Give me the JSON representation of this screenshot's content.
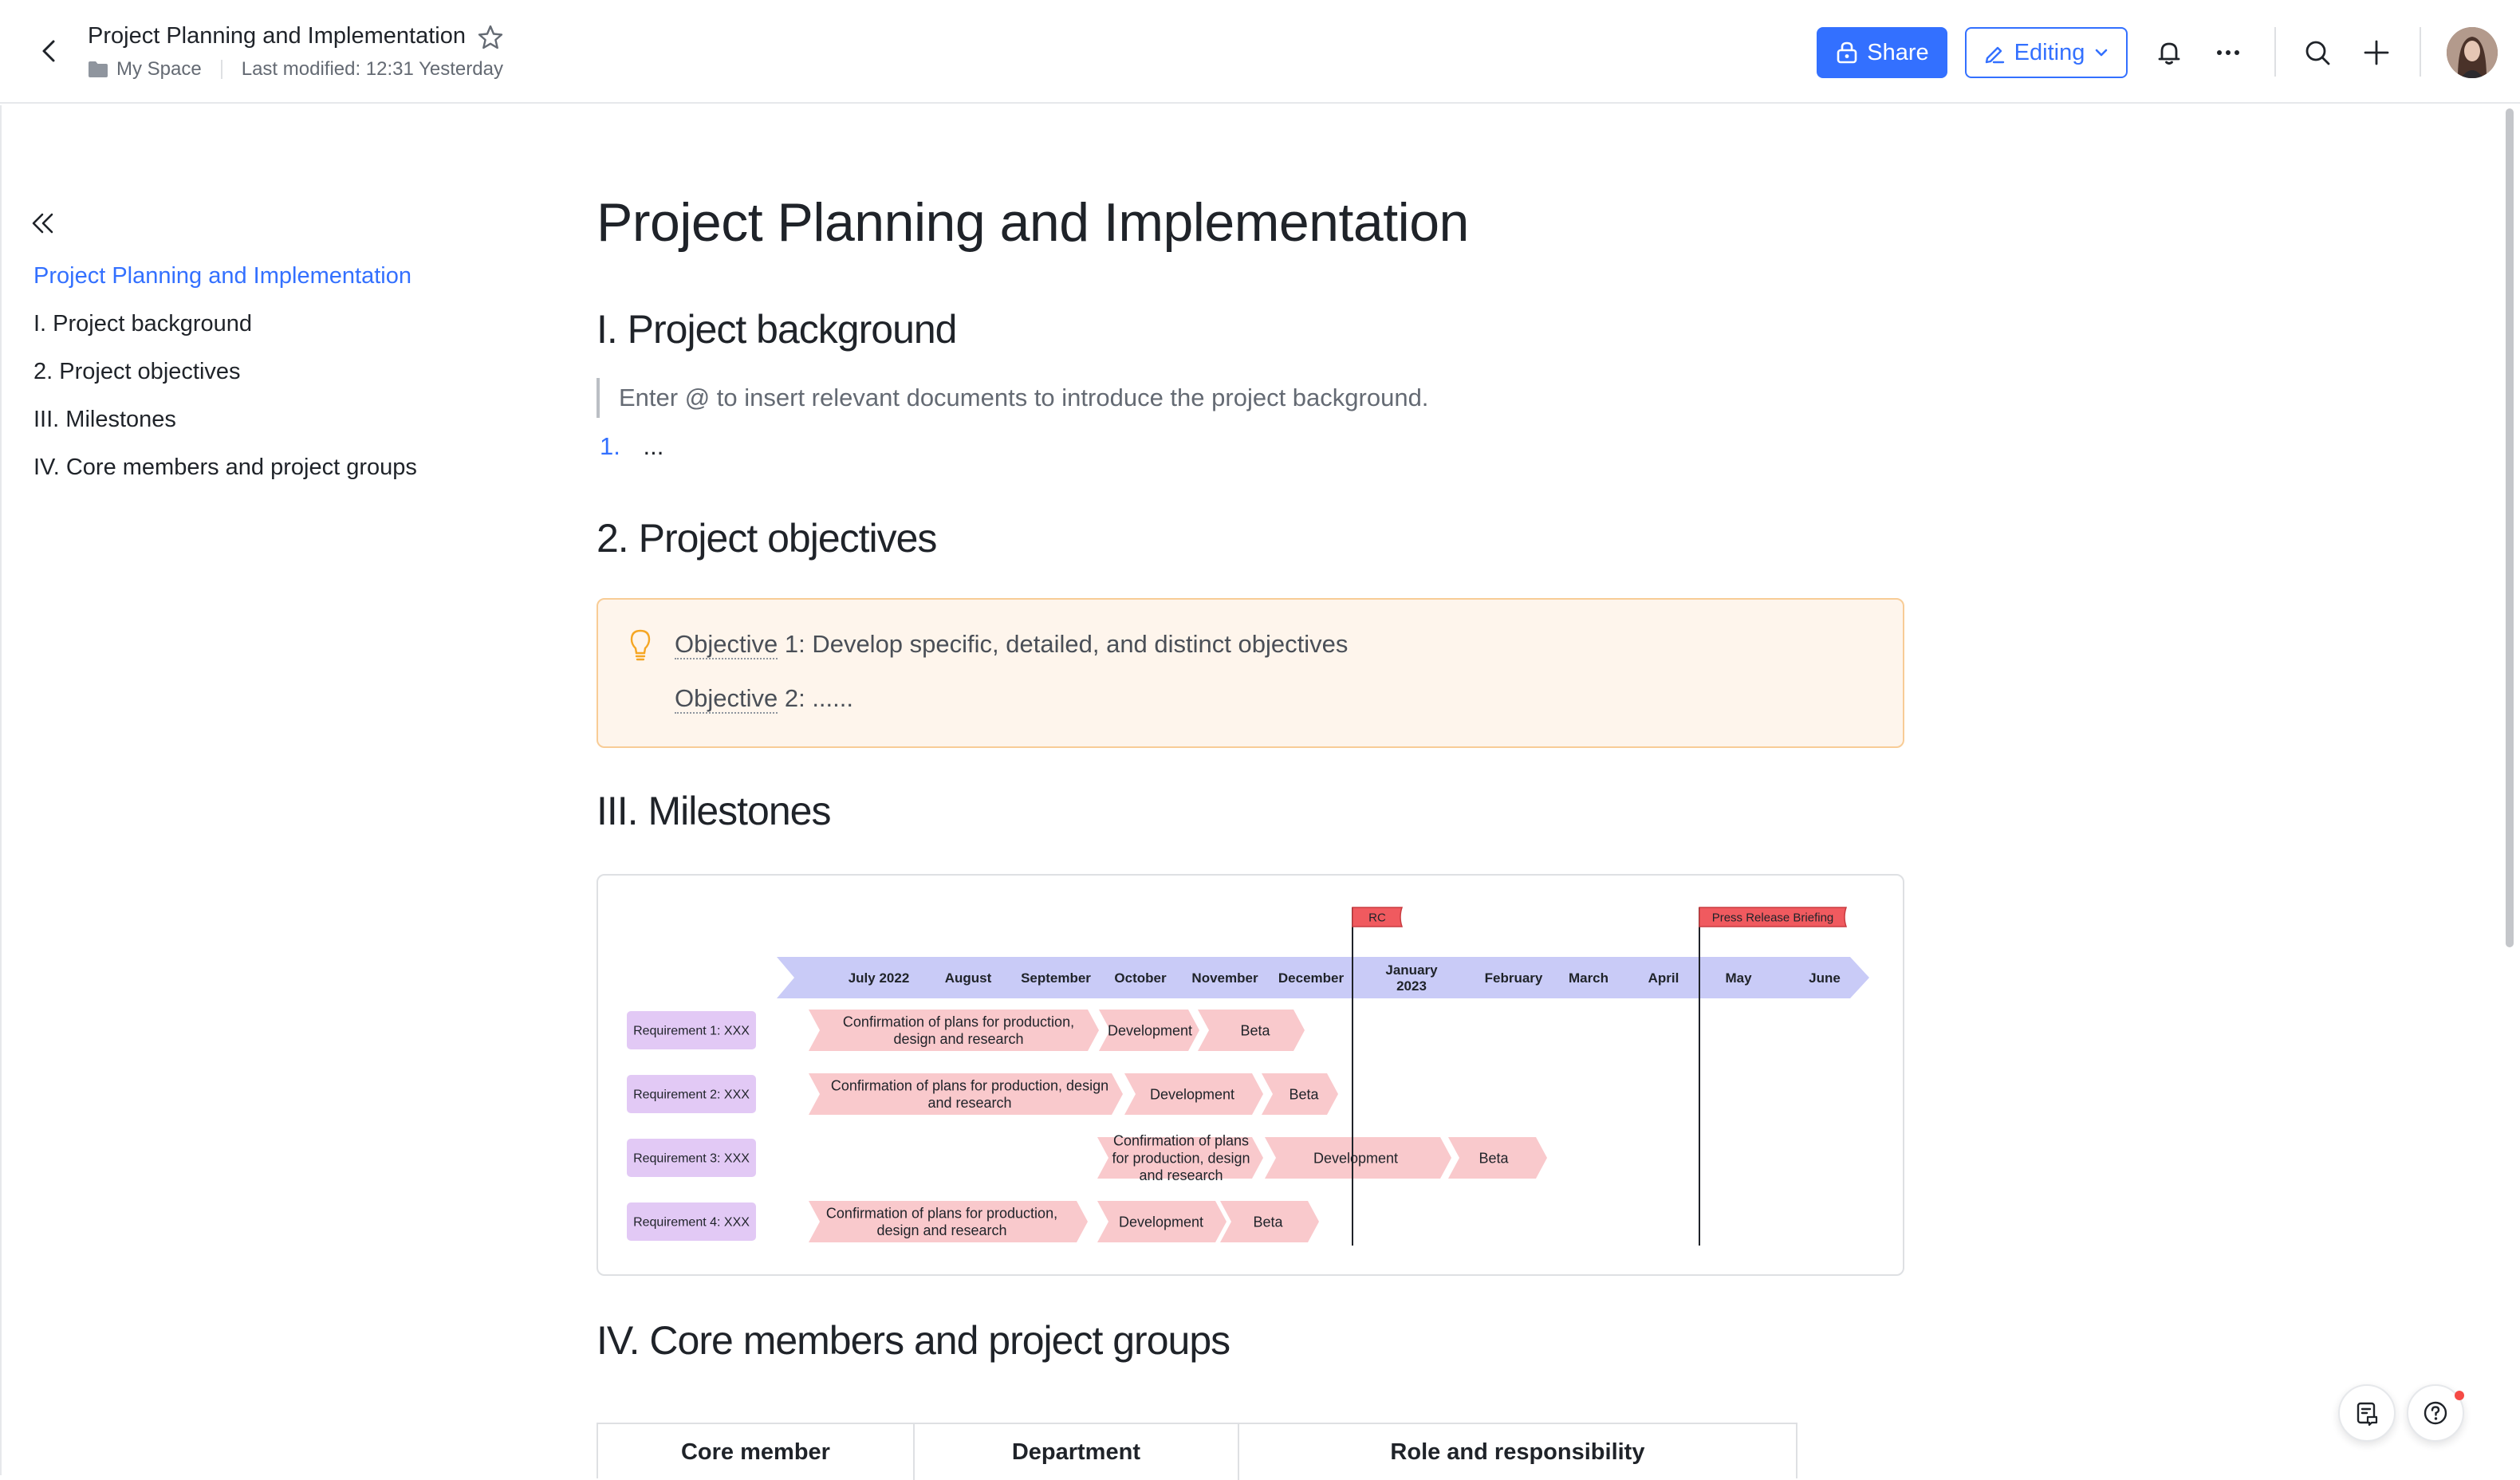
{
  "header": {
    "title": "Project Planning and Implementation",
    "location": "My Space",
    "last_modified": "Last modified: 12:31 Yesterday",
    "share_label": "Share",
    "editing_label": "Editing"
  },
  "outline": {
    "items": [
      {
        "label": "Project Planning and Implementation",
        "active": true
      },
      {
        "label": "I. Project background"
      },
      {
        "label": "2. Project objectives"
      },
      {
        "label": "III. Milestones"
      },
      {
        "label": "IV. Core members and project groups"
      }
    ]
  },
  "doc": {
    "title": "Project Planning and Implementation",
    "section1": {
      "heading": "I. Project background",
      "quote": "Enter @ to insert relevant documents to introduce the project background.",
      "list_num": "1.",
      "list_text": "..."
    },
    "section2": {
      "heading": "2. Project objectives",
      "objectives": [
        {
          "keyword": "Objective",
          "text": " 1: Develop specific, detailed, and distinct objectives"
        },
        {
          "keyword": "Objective",
          "text": " 2: ......"
        }
      ]
    },
    "section3": {
      "heading": "III. Milestones"
    },
    "section4": {
      "heading": "IV. Core members and project groups",
      "table_headers": [
        "Core member",
        "Department",
        "Role and responsibility"
      ]
    }
  },
  "milestones": {
    "months": [
      [
        "July 2022"
      ],
      [
        "August"
      ],
      [
        "September"
      ],
      [
        "October"
      ],
      [
        "November"
      ],
      [
        "December"
      ],
      [
        "January",
        "2023"
      ],
      [
        "February"
      ],
      [
        "March"
      ],
      [
        "April"
      ],
      [
        "May"
      ],
      [
        "June"
      ]
    ],
    "flags": [
      {
        "label": "RC"
      },
      {
        "label": "Press Release Briefing"
      }
    ],
    "rows": [
      {
        "label": "Requirement 1: XXX",
        "tasks": [
          {
            "lines": [
              "Confirmation of plans for production,",
              "design and research"
            ]
          },
          {
            "lines": [
              "Development"
            ]
          },
          {
            "lines": [
              "Beta"
            ]
          }
        ]
      },
      {
        "label": "Requirement 2: XXX",
        "tasks": [
          {
            "lines": [
              "Confirmation of plans for production, design",
              "and research"
            ]
          },
          {
            "lines": [
              "Development"
            ]
          },
          {
            "lines": [
              "Beta"
            ]
          }
        ]
      },
      {
        "label": "Requirement 3: XXX",
        "tasks": [
          {
            "lines": [
              "Confirmation of plans",
              "for production, design",
              "and research"
            ]
          },
          {
            "lines": [
              "Development"
            ]
          },
          {
            "lines": [
              "Beta"
            ]
          }
        ]
      },
      {
        "label": "Requirement 4: XXX",
        "tasks": [
          {
            "lines": [
              "Confirmation of plans for production,",
              "design and research"
            ]
          },
          {
            "lines": [
              "Development"
            ]
          },
          {
            "lines": [
              "Beta"
            ]
          }
        ]
      }
    ],
    "colors": {
      "timeline": "#c9cbf7",
      "requirement": "#e2c9f5",
      "task": "#f9c9cc",
      "flag": "#f05a5f",
      "flag_border": "#c93c41"
    }
  }
}
